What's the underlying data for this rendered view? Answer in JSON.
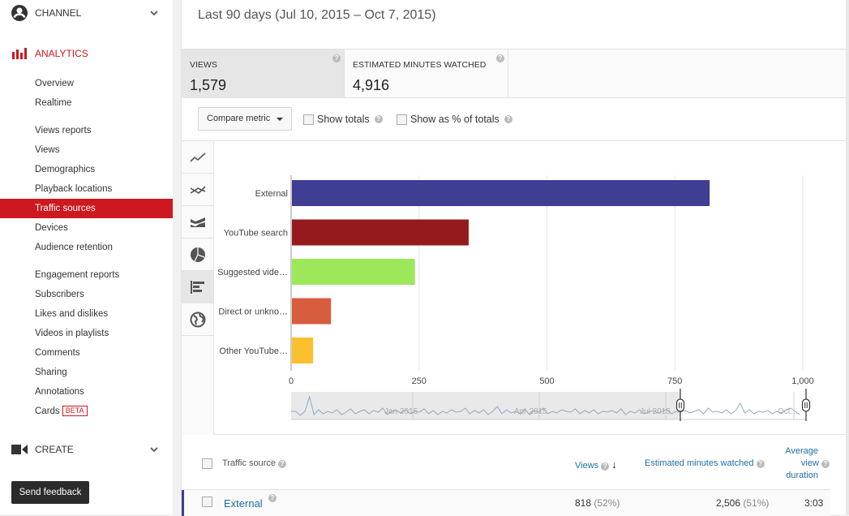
{
  "sidebar": {
    "channel_label": "CHANNEL",
    "analytics_label": "ANALYTICS",
    "create_label": "CREATE",
    "items": [
      {
        "label": "Overview"
      },
      {
        "label": "Realtime"
      },
      {
        "label": "Views reports"
      },
      {
        "label": "Views"
      },
      {
        "label": "Demographics"
      },
      {
        "label": "Playback locations"
      },
      {
        "label": "Traffic sources",
        "active": true
      },
      {
        "label": "Devices"
      },
      {
        "label": "Audience retention"
      },
      {
        "label": "Engagement reports"
      },
      {
        "label": "Subscribers"
      },
      {
        "label": "Likes and dislikes"
      },
      {
        "label": "Videos in playlists"
      },
      {
        "label": "Comments"
      },
      {
        "label": "Sharing"
      },
      {
        "label": "Annotations"
      },
      {
        "label": "Cards",
        "badge": "BETA"
      }
    ],
    "feedback_label": "Send feedback",
    "accent_color": "#cc181e"
  },
  "header": {
    "date_range": "Last 90 days (Jul 10, 2015 – Oct 7, 2015)"
  },
  "metrics": [
    {
      "title": "VIEWS",
      "value": "1,579",
      "selected": true
    },
    {
      "title": "ESTIMATED MINUTES WATCHED",
      "value": "4,916",
      "selected": false
    }
  ],
  "controls": {
    "compare_label": "Compare metric",
    "show_totals": "Show totals",
    "show_pct": "Show as % of totals",
    "help": "?"
  },
  "chart_types": [
    "line-chart-icon",
    "multiline-chart-icon",
    "stacked-area-icon",
    "pie-chart-icon",
    "bar-chart-icon",
    "map-globe-icon"
  ],
  "chart_data": {
    "type": "bar",
    "orientation": "horizontal",
    "categories": [
      "External",
      "YouTube search",
      "Suggested vide…",
      "Direct or unkno…",
      "Other YouTube…"
    ],
    "values": [
      818,
      347,
      242,
      78,
      43
    ],
    "colors": [
      "#3f3d94",
      "#951a1d",
      "#9de85a",
      "#d85c3e",
      "#fbc02d"
    ],
    "xlim": [
      0,
      1000
    ],
    "xticks": [
      0,
      250,
      500,
      750,
      1000
    ],
    "xtick_labels": [
      "0",
      "250",
      "500",
      "750",
      "1,000"
    ],
    "grid": true,
    "timeline_labels": [
      "Jan 2015",
      "Apr 2015",
      "Jul 2015",
      "Oct…"
    ]
  },
  "table": {
    "headers": {
      "source": "Traffic source",
      "views": "Views",
      "minutes": "Estimated minutes watched",
      "avg1": "Average",
      "avg2": "view",
      "avg3": "duration",
      "sort_arrow": "↓"
    },
    "rows": [
      {
        "source": "External",
        "views": "818",
        "views_pct": "(52%)",
        "minutes": "2,506",
        "minutes_pct": "(51%)",
        "avg": "3:03"
      }
    ]
  }
}
